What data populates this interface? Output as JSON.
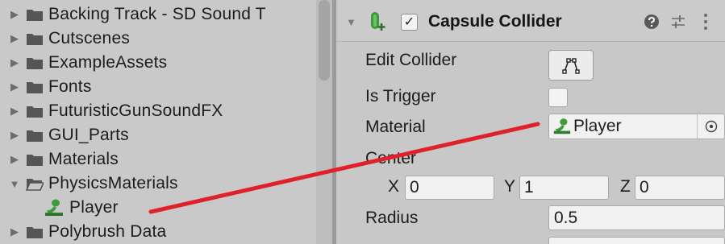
{
  "project": {
    "items": [
      {
        "label": "Backing Track - SD Sound T",
        "expanded": false,
        "type": "folder"
      },
      {
        "label": "Cutscenes",
        "expanded": false,
        "type": "folder"
      },
      {
        "label": "ExampleAssets",
        "expanded": false,
        "type": "folder"
      },
      {
        "label": "Fonts",
        "expanded": false,
        "type": "folder"
      },
      {
        "label": "FuturisticGunSoundFX",
        "expanded": false,
        "type": "folder"
      },
      {
        "label": "GUI_Parts",
        "expanded": false,
        "type": "folder"
      },
      {
        "label": "Materials",
        "expanded": false,
        "type": "folder"
      },
      {
        "label": "PhysicsMaterials",
        "expanded": true,
        "type": "folder-open"
      },
      {
        "label": "Player",
        "type": "physics-material"
      },
      {
        "label": "Polybrush Data",
        "expanded": false,
        "type": "folder"
      }
    ]
  },
  "inspector": {
    "component_title": "Capsule Collider",
    "enabled_check": "✓",
    "edit_collider_label": "Edit Collider",
    "is_trigger_label": "Is Trigger",
    "material_label": "Material",
    "material_value": "Player",
    "center_label": "Center",
    "center": {
      "x_label": "X",
      "x": "0",
      "y_label": "Y",
      "y": "1",
      "z_label": "Z",
      "z": "0"
    },
    "radius_label": "Radius",
    "radius_value": "0.5"
  },
  "icons": {
    "foldout_closed": "triangle-right-icon",
    "foldout_open": "triangle-down-icon",
    "folder": "folder-icon",
    "physics_material": "physics-material-icon",
    "capsule_collider": "capsule-collider-icon",
    "help": "help-icon",
    "presets": "presets-icon",
    "menu": "kebab-menu-icon",
    "edit_collider": "edit-collider-icon",
    "object_picker": "object-picker-icon"
  },
  "colors": {
    "annotation_line": "#e0202a",
    "physics_material_green": "#3f9a3c",
    "collider_green": "#3c9a3c"
  }
}
